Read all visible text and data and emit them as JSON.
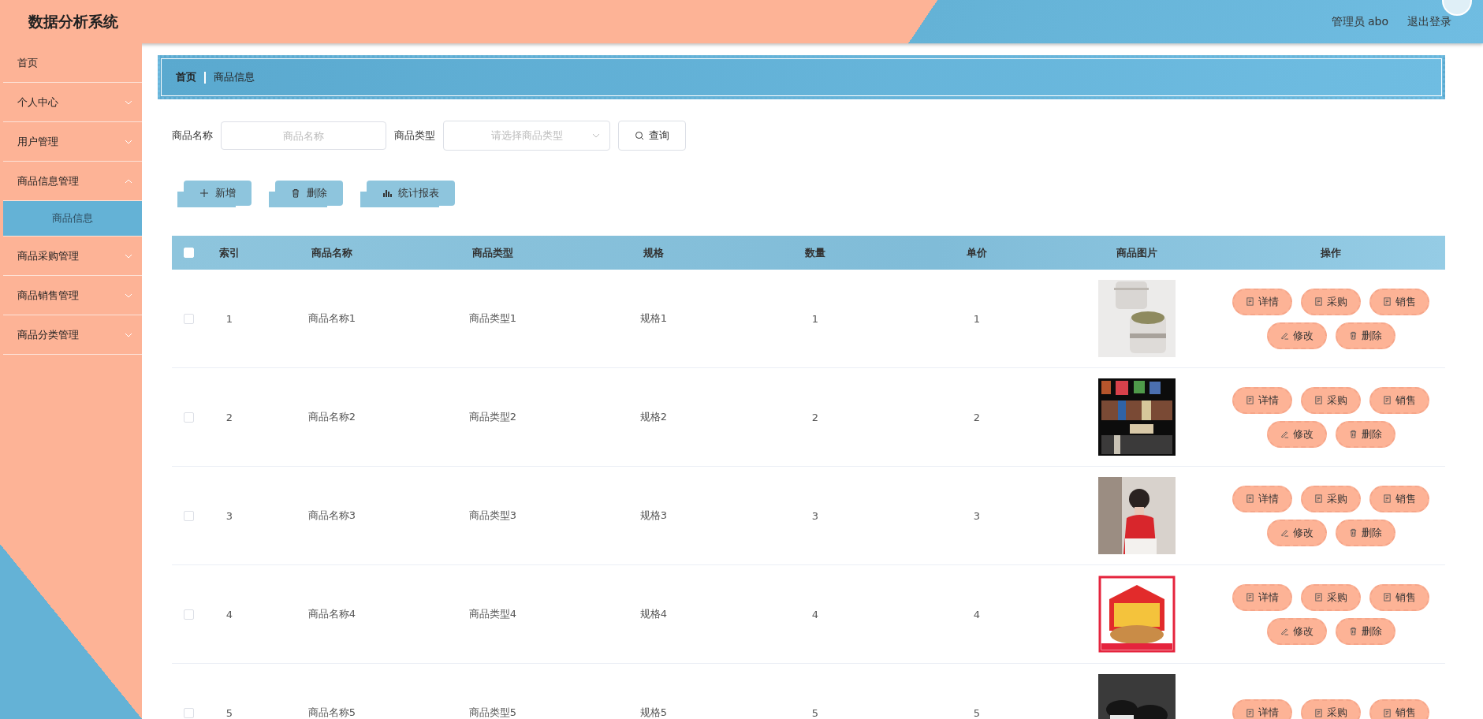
{
  "header": {
    "title": "数据分析系统",
    "user": "管理员 abo",
    "logout": "退出登录"
  },
  "sidebar": {
    "items": [
      {
        "kind": "link",
        "label": "首页"
      },
      {
        "kind": "menu",
        "label": "个人中心",
        "expanded": false
      },
      {
        "kind": "menu",
        "label": "用户管理",
        "expanded": false
      },
      {
        "kind": "menu",
        "label": "商品信息管理",
        "expanded": true,
        "children": [
          {
            "label": "商品信息",
            "selected": true
          }
        ]
      },
      {
        "kind": "menu",
        "label": "商品采购管理",
        "expanded": false
      },
      {
        "kind": "menu",
        "label": "商品销售管理",
        "expanded": false
      },
      {
        "kind": "menu",
        "label": "商品分类管理",
        "expanded": false
      }
    ]
  },
  "breadcrumb": [
    "首页",
    "商品信息"
  ],
  "search": {
    "name_label": "商品名称",
    "name_placeholder": "商品名称",
    "type_label": "商品类型",
    "type_placeholder": "请选择商品类型",
    "query": "查询"
  },
  "toolbar": [
    {
      "kind": "add",
      "label": "新增"
    },
    {
      "kind": "delete",
      "label": "删除"
    },
    {
      "kind": "chart",
      "label": "统计报表"
    }
  ],
  "table": {
    "header_checked": false,
    "columns": [
      "索引",
      "商品名称",
      "商品类型",
      "规格",
      "数量",
      "单价",
      "商品图片",
      "操作"
    ],
    "rows": [
      {
        "checked": false,
        "cells": [
          "1",
          "商品名称1",
          "商品类型1",
          "规格1",
          "1",
          "1"
        ],
        "picture": {
          "kind": "picture"
        },
        "actions": [
          {
            "kind": "doc",
            "label": "详情"
          },
          {
            "kind": "doc",
            "label": "采购"
          },
          {
            "kind": "doc",
            "label": "销售"
          },
          {
            "kind": "edit",
            "label": "修改"
          },
          {
            "kind": "trash",
            "label": "删除"
          }
        ]
      },
      {
        "checked": false,
        "cells": [
          "2",
          "商品名称2",
          "商品类型2",
          "规格2",
          "2",
          "2"
        ],
        "picture": {
          "kind": "picture"
        },
        "actions": [
          {
            "kind": "doc",
            "label": "详情"
          },
          {
            "kind": "doc",
            "label": "采购"
          },
          {
            "kind": "doc",
            "label": "销售"
          },
          {
            "kind": "edit",
            "label": "修改"
          },
          {
            "kind": "trash",
            "label": "删除"
          }
        ]
      },
      {
        "checked": false,
        "cells": [
          "3",
          "商品名称3",
          "商品类型3",
          "规格3",
          "3",
          "3"
        ],
        "picture": {
          "kind": "picture"
        },
        "actions": [
          {
            "kind": "doc",
            "label": "详情"
          },
          {
            "kind": "doc",
            "label": "采购"
          },
          {
            "kind": "doc",
            "label": "销售"
          },
          {
            "kind": "edit",
            "label": "修改"
          },
          {
            "kind": "trash",
            "label": "删除"
          }
        ]
      },
      {
        "checked": false,
        "cells": [
          "4",
          "商品名称4",
          "商品类型4",
          "规格4",
          "4",
          "4"
        ],
        "picture": {
          "kind": "picture"
        },
        "actions": [
          {
            "kind": "doc",
            "label": "详情"
          },
          {
            "kind": "doc",
            "label": "采购"
          },
          {
            "kind": "doc",
            "label": "销售"
          },
          {
            "kind": "edit",
            "label": "修改"
          },
          {
            "kind": "trash",
            "label": "删除"
          }
        ]
      },
      {
        "checked": false,
        "cells": [
          "5",
          "商品名称5",
          "商品类型5",
          "规格5",
          "5",
          "5"
        ],
        "picture": {
          "kind": "picture"
        },
        "actions": [
          {
            "kind": "doc",
            "label": "详情"
          },
          {
            "kind": "doc",
            "label": "采购"
          },
          {
            "kind": "doc",
            "label": "销售"
          }
        ]
      }
    ]
  }
}
